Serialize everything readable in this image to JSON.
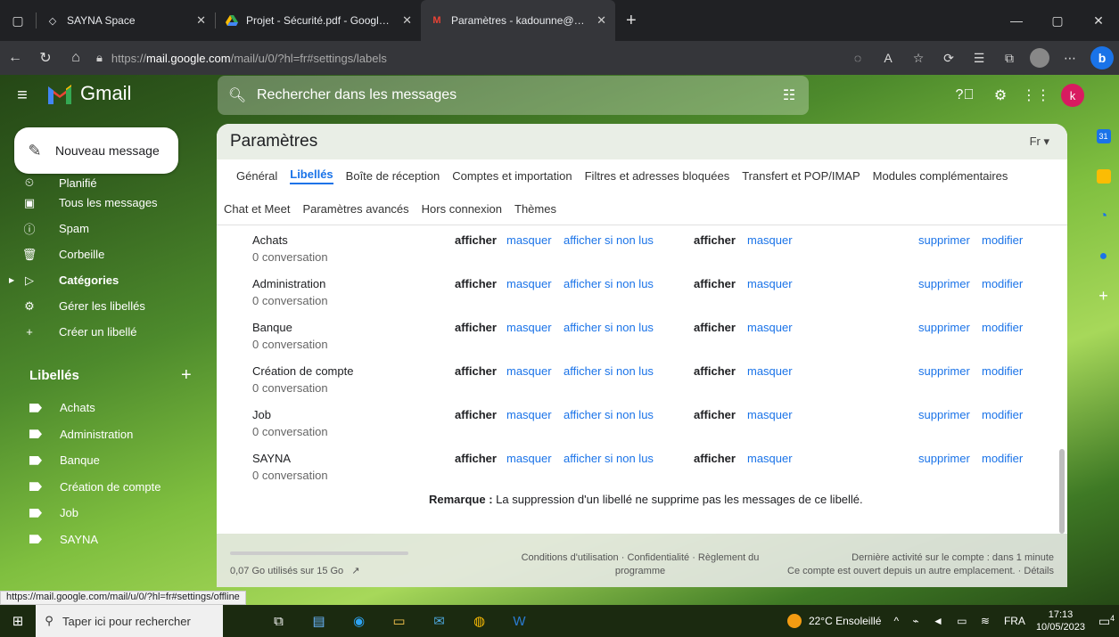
{
  "browser": {
    "tabs": [
      {
        "label": "SAYNA Space",
        "icon": "sayna-icon"
      },
      {
        "label": "Projet - Sécurité.pdf - Google Dr",
        "icon": "google-drive-icon"
      },
      {
        "label": "Paramètres - kadounne@gmail.c",
        "icon": "gmail-icon"
      }
    ],
    "url_scheme": "https://",
    "url_host": "mail.google.com",
    "url_path": "/mail/u/0/?hl=fr#settings/labels"
  },
  "gmail": {
    "brand": "Gmail",
    "search_placeholder": "Rechercher dans les messages",
    "account_initial": "k",
    "compose_label": "Nouveau message"
  },
  "sidebar": {
    "items": [
      {
        "label": "Planifié",
        "icon": "schedule-icon"
      },
      {
        "label": "Tous les messages",
        "icon": "all-mail-icon"
      },
      {
        "label": "Spam",
        "icon": "spam-icon"
      },
      {
        "label": "Corbeille",
        "icon": "trash-icon"
      },
      {
        "label": "Catégories",
        "icon": "label-outline-icon"
      },
      {
        "label": "Gérer les libellés",
        "icon": "gear-icon"
      },
      {
        "label": "Créer un libellé",
        "icon": "plus-icon"
      }
    ],
    "labels_title": "Libellés",
    "labels": [
      "Achats",
      "Administration",
      "Banque",
      "Création de compte",
      "Job",
      "SAYNA"
    ]
  },
  "settings": {
    "title": "Paramètres",
    "lang": "Fr",
    "tabs_row1": [
      "Général",
      "Libellés",
      "Boîte de réception",
      "Comptes et importation",
      "Filtres et adresses bloquées",
      "Transfert et POP/IMAP",
      "Modules complémentaires"
    ],
    "tabs_row2": [
      "Chat et Meet",
      "Paramètres avancés",
      "Hors connexion",
      "Thèmes"
    ],
    "action_show": "afficher",
    "action_hide": "masquer",
    "action_show_unread": "afficher si non lus",
    "action_delete": "supprimer",
    "action_edit": "modifier",
    "rows": [
      {
        "name": "Achats",
        "count": "0 conversation"
      },
      {
        "name": "Administration",
        "count": "0 conversation"
      },
      {
        "name": "Banque",
        "count": "0 conversation"
      },
      {
        "name": "Création de compte",
        "count": "0 conversation"
      },
      {
        "name": "Job",
        "count": "0 conversation"
      },
      {
        "name": "SAYNA",
        "count": "0 conversation"
      }
    ],
    "note_label": "Remarque :",
    "note_text": " La suppression d'un libellé ne supprime pas les messages de ce libellé."
  },
  "footer": {
    "storage": "0,07 Go utilisés sur 15 Go",
    "terms_line1": "Conditions d'utilisation · Confidentialité · Règlement du",
    "terms_line2": "programme",
    "activity_line1": "Dernière activité sur le compte : dans 1 minute",
    "activity_line2": "Ce compte est ouvert depuis un autre emplacement. · Détails"
  },
  "status_url": "https://mail.google.com/mail/u/0/?hl=fr#settings/offline",
  "taskbar": {
    "search_placeholder": "Taper ici pour rechercher",
    "weather": "22°C Ensoleillé",
    "lang": "FRA",
    "time": "17:13",
    "date": "10/05/2023",
    "notifications": "4"
  }
}
